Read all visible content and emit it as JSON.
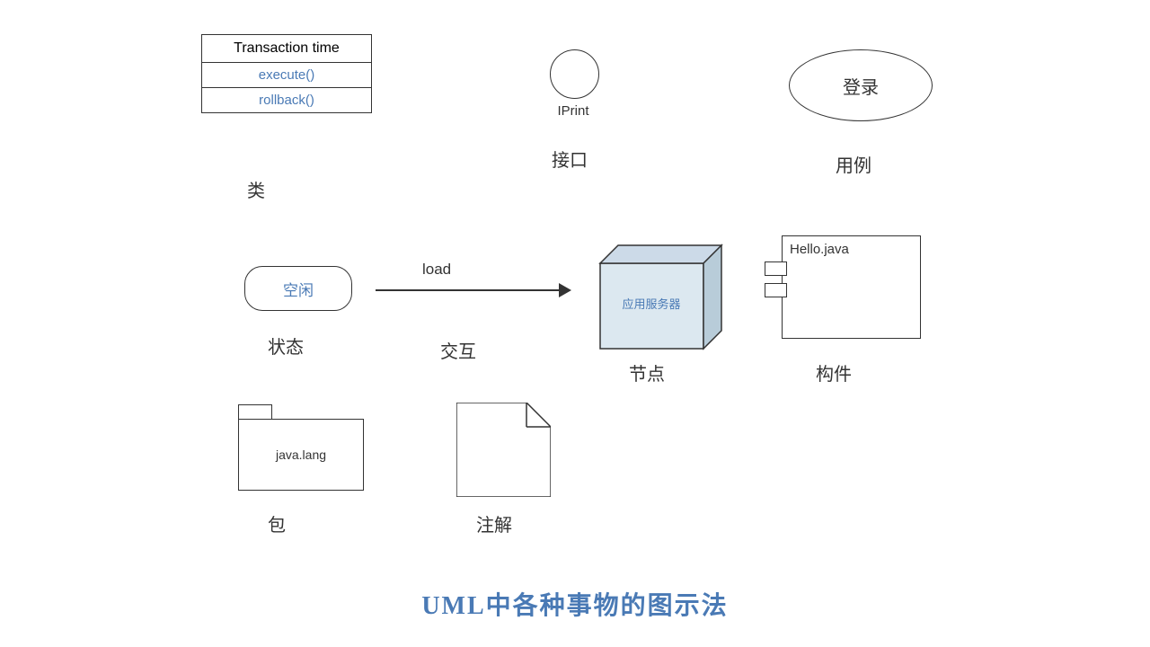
{
  "row1": {
    "class": {
      "title": "Transaction time",
      "method1": "execute()",
      "method2": "rollback()",
      "label": "类"
    },
    "interface": {
      "name": "IPrint",
      "label": "接口"
    },
    "usecase": {
      "text": "登录",
      "label": "用例"
    }
  },
  "row2": {
    "state": {
      "text": "空闲",
      "label": "状态"
    },
    "interaction": {
      "arrow_label": "load",
      "label": "交互"
    },
    "node": {
      "text": "应用服务器",
      "label": "节点"
    },
    "component": {
      "title": "Hello.java",
      "label": "构件"
    }
  },
  "row3": {
    "package": {
      "text": "java.lang",
      "label": "包"
    },
    "note": {
      "label": "注解"
    }
  },
  "footer": {
    "title": "UML中各种事物的图示法"
  }
}
